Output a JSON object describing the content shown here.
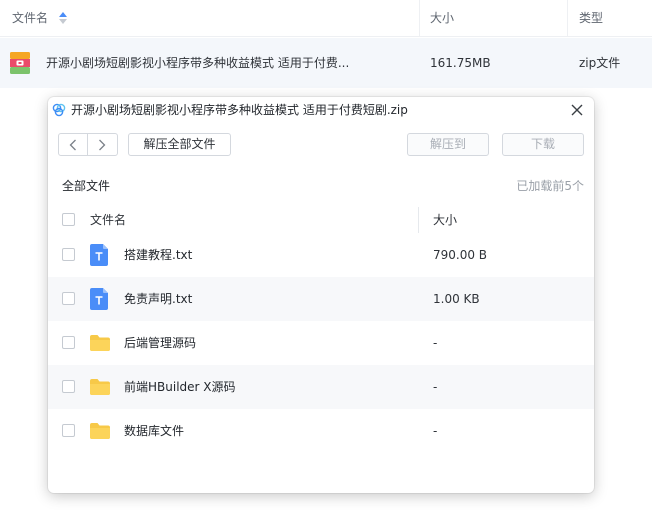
{
  "background_list": {
    "columns": {
      "name": "文件名",
      "size": "大小",
      "type": "类型"
    },
    "row": {
      "name": "开源小剧场短剧影视小程序带多种收益模式 适用于付费...",
      "size": "161.75MB",
      "type": "zip文件"
    }
  },
  "dialog": {
    "title": "开源小剧场短剧影视小程序带多种收益模式 适用于付费短剧.zip",
    "toolbar": {
      "back_icon": "chevron-left-icon",
      "forward_icon": "chevron-right-icon",
      "extract_all_label": "解压全部文件",
      "extract_to_label": "解压到",
      "download_label": "下载"
    },
    "breadcrumb": "全部文件",
    "loaded_text": "已加载前5个",
    "table": {
      "headers": {
        "name": "文件名",
        "size": "大小"
      },
      "rows": [
        {
          "name": "搭建教程.txt",
          "size": "790.00 B",
          "icon": "txt-file-icon"
        },
        {
          "name": "免责声明.txt",
          "size": "1.00 KB",
          "icon": "txt-file-icon"
        },
        {
          "name": "后端管理源码",
          "size": "-",
          "icon": "folder-icon"
        },
        {
          "name": "前端HBuilder X源码",
          "size": "-",
          "icon": "folder-icon"
        },
        {
          "name": "数据库文件",
          "size": "-",
          "icon": "folder-icon"
        }
      ]
    }
  },
  "colors": {
    "folder": "#f7c948",
    "txt_icon": "#4a8df8",
    "sort_active": "#4a8df8",
    "row_highlight": "#f4f7fb"
  }
}
